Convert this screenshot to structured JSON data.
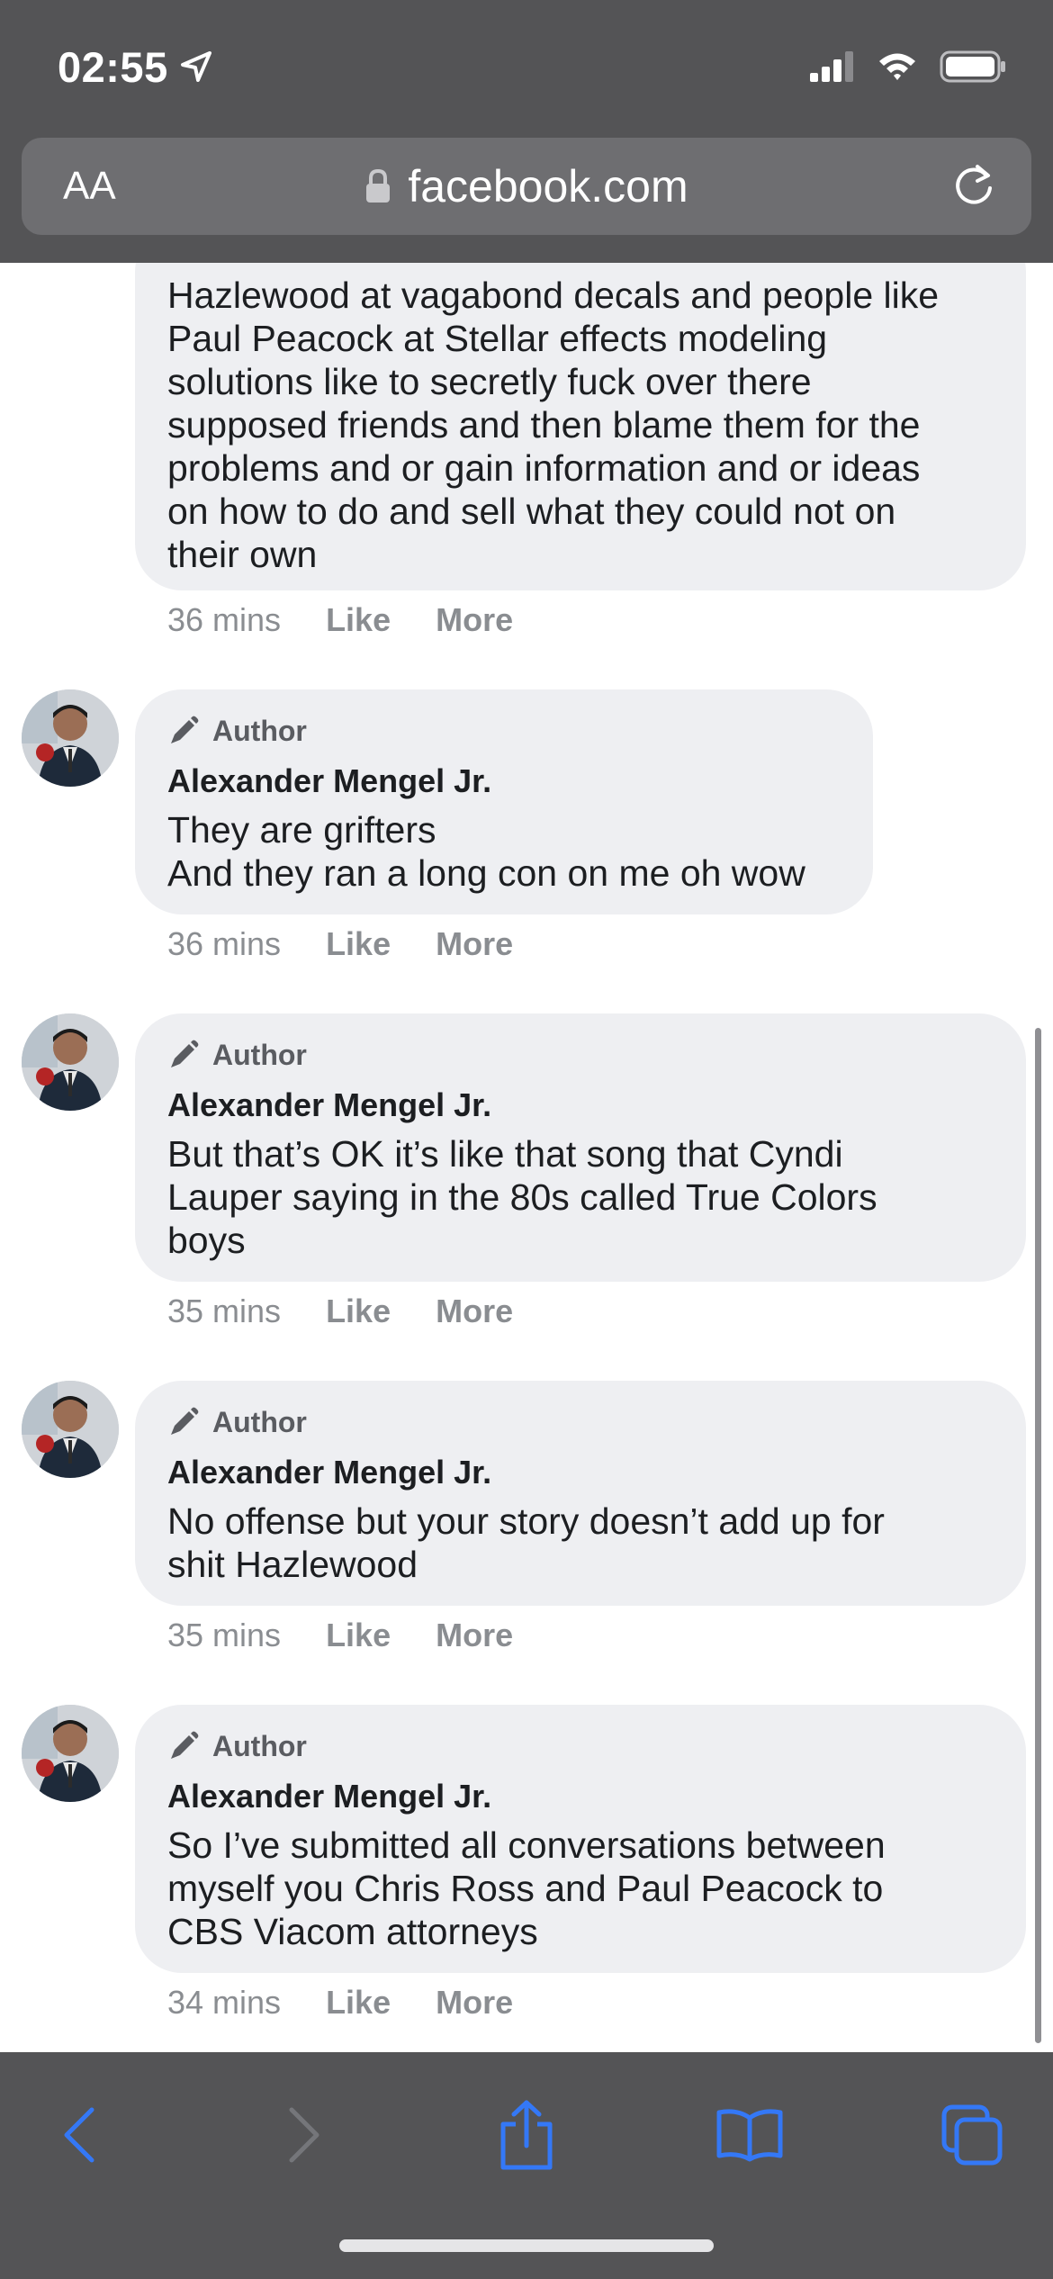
{
  "status_bar": {
    "time": "02:55"
  },
  "url_bar": {
    "text_size_label": "AA",
    "domain": "facebook.com"
  },
  "colors": {
    "accent": "#3478f6",
    "chrome": "#545456",
    "bubble": "#eeeff2"
  },
  "comments": [
    {
      "text": "Hazlewood at vagabond decals and people like\nPaul Peacock at Stellar effects modeling\nsolutions like to secretly fuck over there\nsupposed friends and then blame them for the\nproblems and or gain information and or ideas\non how to do and sell what they could not on\ntheir own",
      "time": "36 mins",
      "like": "Like",
      "more": "More"
    },
    {
      "badge": "Author",
      "author": "Alexander Mengel Jr.",
      "text": "They are grifters\nAnd they ran a long con on me oh wow",
      "time": "36 mins",
      "like": "Like",
      "more": "More"
    },
    {
      "badge": "Author",
      "author": "Alexander Mengel Jr.",
      "text": "But that’s OK it’s like that song that Cyndi\nLauper saying in the 80s called True Colors\nboys",
      "time": "35 mins",
      "like": "Like",
      "more": "More"
    },
    {
      "badge": "Author",
      "author": "Alexander Mengel Jr.",
      "text": "No offense but your story doesn’t add up for\nshit Hazlewood",
      "time": "35 mins",
      "like": "Like",
      "more": "More"
    },
    {
      "badge": "Author",
      "author": "Alexander Mengel Jr.",
      "text": "So I’ve submitted all conversations between\nmyself you Chris Ross and Paul Peacock to\nCBS Viacom attorneys",
      "time": "34 mins",
      "like": "Like",
      "more": "More"
    }
  ],
  "toolbar": {
    "icons": [
      "back-icon",
      "forward-icon",
      "share-icon",
      "bookmarks-icon",
      "tabs-icon"
    ]
  }
}
